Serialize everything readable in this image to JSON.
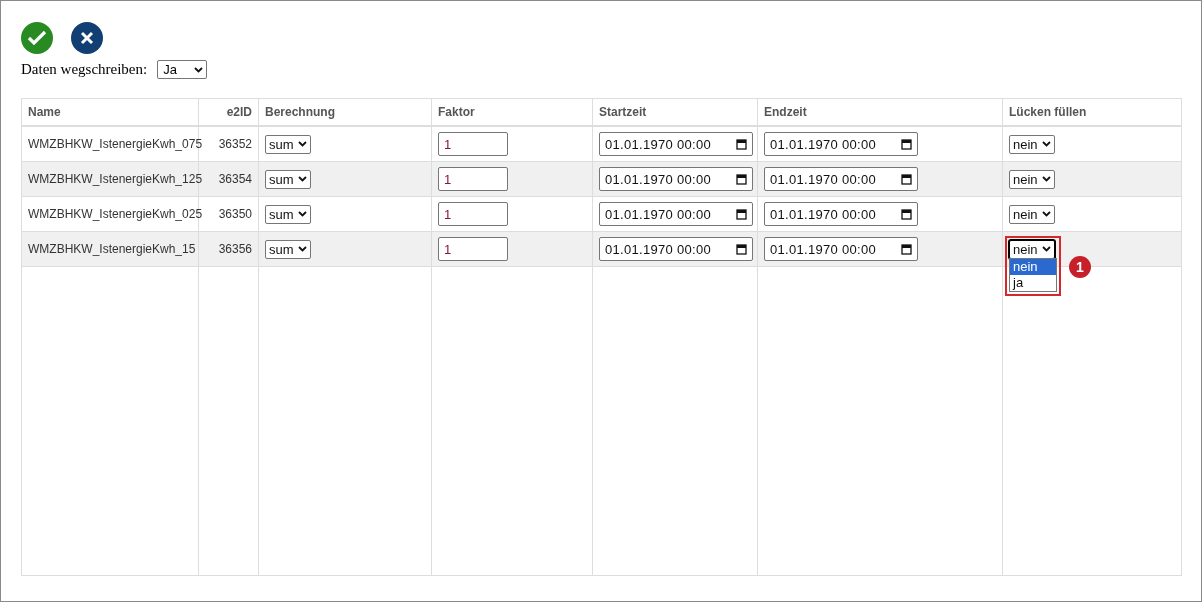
{
  "toolbar": {
    "write_label": "Daten wegschreiben:",
    "write_value": "Ja"
  },
  "table": {
    "columns": [
      "Name",
      "e2ID",
      "Berechnung",
      "Faktor",
      "Startzeit",
      "Endzeit",
      "Lücken füllen"
    ],
    "rows": [
      {
        "name": "WMZBHKW_IstenergieKwh_075",
        "e2id": "36352",
        "calc": "sum",
        "factor": "1",
        "start": "01.01.1970 00:00",
        "end": "01.01.1970 00:00",
        "fill_gaps": {
          "value": "nein",
          "open": false
        }
      },
      {
        "name": "WMZBHKW_IstenergieKwh_125",
        "e2id": "36354",
        "calc": "sum",
        "factor": "1",
        "start": "01.01.1970 00:00",
        "end": "01.01.1970 00:00",
        "fill_gaps": {
          "value": "nein",
          "open": false
        }
      },
      {
        "name": "WMZBHKW_IstenergieKwh_025",
        "e2id": "36350",
        "calc": "sum",
        "factor": "1",
        "start": "01.01.1970 00:00",
        "end": "01.01.1970 00:00",
        "fill_gaps": {
          "value": "nein",
          "open": false
        }
      },
      {
        "name": "WMZBHKW_IstenergieKwh_15",
        "e2id": "36356",
        "calc": "sum",
        "factor": "1",
        "start": "01.01.1970 00:00",
        "end": "01.01.1970 00:00",
        "fill_gaps": {
          "value": "nein",
          "open": true,
          "options": [
            {
              "label": "nein",
              "selected": true
            },
            {
              "label": "ja",
              "selected": false
            }
          ],
          "annotation": "1"
        }
      }
    ]
  }
}
